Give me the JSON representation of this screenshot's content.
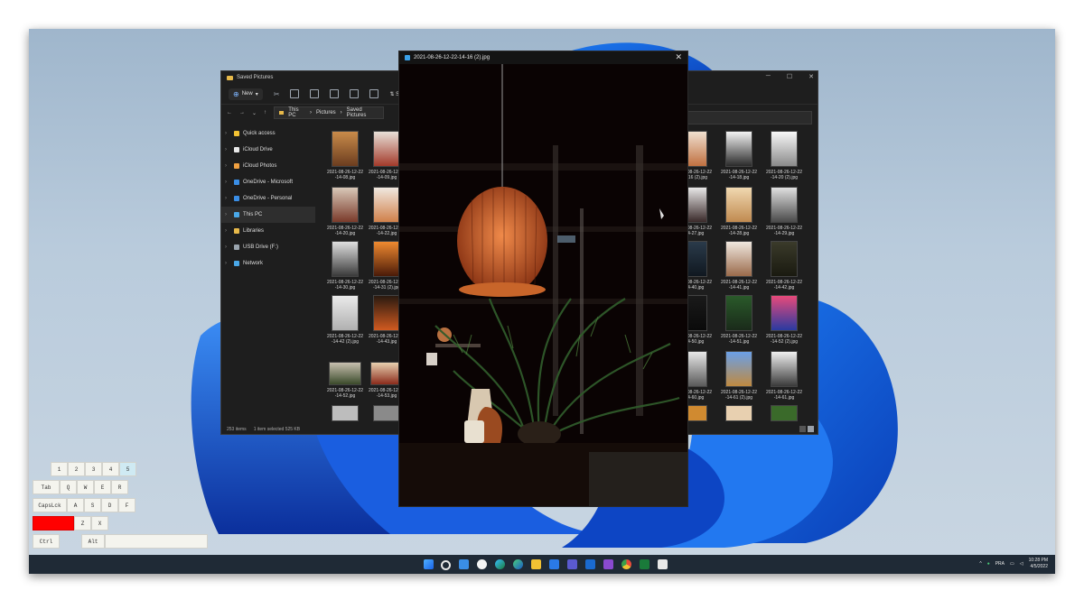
{
  "colors": {
    "accent": "#1a63e8",
    "taskbar": "#1f2a36",
    "explorer_bg": "#1e1e1e",
    "capslock_active": "#ff0000"
  },
  "explorer": {
    "title": "Saved Pictures",
    "toolbar": {
      "new_label": "New",
      "sort_label": "So"
    },
    "breadcrumb": [
      "This PC",
      "Pictures",
      "Saved Pictures"
    ],
    "nav": [
      {
        "label": "Quick access",
        "icon": "star-icon"
      },
      {
        "label": "iCloud Drive",
        "icon": "cloud-icon"
      },
      {
        "label": "iCloud Photos",
        "icon": "photos-icon"
      },
      {
        "label": "OneDrive - Microsoft",
        "icon": "onedrive-icon"
      },
      {
        "label": "OneDrive - Personal",
        "icon": "onedrive-icon"
      },
      {
        "label": "This PC",
        "icon": "pc-icon",
        "selected": true
      },
      {
        "label": "Libraries",
        "icon": "library-icon"
      },
      {
        "label": "USB Drive (F:)",
        "icon": "usb-icon"
      },
      {
        "label": "Network",
        "icon": "network-icon"
      }
    ],
    "files": [
      {
        "l1": "2021-08-26-12-22",
        "l2": "-14-08.jpg"
      },
      {
        "l1": "2021-08-26-12-22",
        "l2": "-14-09.jpg"
      },
      {
        "l1": "2021-08-26-12-22",
        "l2": "-14-16 (2).jpg"
      },
      {
        "l1": "2021-08-26-12-22",
        "l2": "-14-18.jpg"
      },
      {
        "l1": "2021-08-26-12-22",
        "l2": "-14-20 (2).jpg"
      },
      {
        "l1": "2021-08-26-12-22",
        "l2": "-14-20.jpg"
      },
      {
        "l1": "2021-08-26-12-22",
        "l2": "-14-22.jpg"
      },
      {
        "l1": "2021-08-26-12-22",
        "l2": "-14-27.jpg"
      },
      {
        "l1": "2021-08-26-12-22",
        "l2": "-14-28.jpg"
      },
      {
        "l1": "2021-08-26-12-22",
        "l2": "-14-29.jpg"
      },
      {
        "l1": "2021-08-26-12-22",
        "l2": "-14-30.jpg"
      },
      {
        "l1": "2021-08-26-12-22",
        "l2": "-14-31 (2).jpg"
      },
      {
        "l1": "2021-08-26-12-22",
        "l2": "-14-40.jpg"
      },
      {
        "l1": "2021-08-26-12-22",
        "l2": "-14-41.jpg"
      },
      {
        "l1": "2021-08-26-12-22",
        "l2": "-14-42.jpg"
      },
      {
        "l1": "2021-08-26-12-22",
        "l2": "-14-42 (2).jpg"
      },
      {
        "l1": "2021-08-26-12-22",
        "l2": "-14-43.jpg"
      },
      {
        "l1": "2021-08-26-12-22",
        "l2": "-14-50.jpg"
      },
      {
        "l1": "2021-08-26-12-22",
        "l2": "-14-51.jpg"
      },
      {
        "l1": "2021-08-26-12-22",
        "l2": "-14-52 (2).jpg"
      },
      {
        "l1": "2021-08-26-12-22",
        "l2": "-14-52.jpg"
      },
      {
        "l1": "2021-08-26-12-22",
        "l2": "-14-53.jpg"
      },
      {
        "l1": "2021-08-26-12-22",
        "l2": "-14-60.jpg"
      },
      {
        "l1": "2021-08-26-12-22",
        "l2": "-14-61 (2).jpg"
      },
      {
        "l1": "2021-08-26-12-22",
        "l2": "-14-61.jpg"
      }
    ],
    "status": {
      "count": "253 items",
      "selection": "1 item selected  525 KB"
    }
  },
  "viewer": {
    "title": "2021-08-26-12-22-14-16 (2).jpg",
    "close": "✕"
  },
  "keyboard": {
    "row1": [
      "1",
      "2",
      "3",
      "4",
      "5"
    ],
    "row2": [
      "Tab",
      "Q",
      "W",
      "E",
      "R"
    ],
    "row3": [
      "CapsLck",
      "A",
      "S",
      "D",
      "F"
    ],
    "row4": [
      "Z",
      "X"
    ],
    "row5": [
      "Ctrl",
      "Alt"
    ]
  },
  "taskbar": {
    "icons": [
      "start-icon",
      "search-icon",
      "widgets-icon",
      "chat-icon",
      "edge-icon",
      "edge-beta-icon",
      "file-explorer-icon",
      "store-icon",
      "teams-icon",
      "outlook-icon",
      "visual-studio-icon",
      "chrome-icon",
      "excel-icon",
      "app-icon"
    ],
    "tray": {
      "lang": "PRA",
      "time": "10:28 PM",
      "date": "4/5/2022"
    }
  }
}
